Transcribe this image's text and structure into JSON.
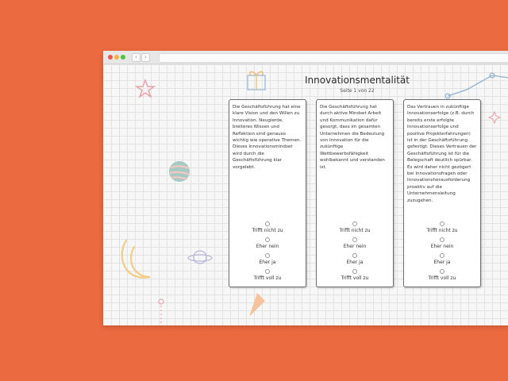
{
  "header": {
    "title": "Innovationsmentalität",
    "page_indicator": "Seite 1 von 22"
  },
  "browser": {
    "back_label": "‹",
    "forward_label": "›"
  },
  "answer_options": [
    "Trifft nicht zu",
    "Eher nein",
    "Eher ja",
    "Trifft voll zu"
  ],
  "cards": [
    {
      "statement": "Die Geschäftsführung hat eine klare Vision und den Willen zu Innovation. Neugierde, breiteres Wissen und Reflektion sind genauso wichtig wie operative Themen. Dieses Innovationsmindset wird durch die Geschäftsführung klar vorgelebt."
    },
    {
      "statement": "Die Geschäftsführung hat durch aktive Mindset Arbeit und Kommunikation dafür gesorgt, dass im gesamten Unternehmen die Bedeutung von Innovation für die zukünftige Wettbewerbsfähigkeit wohlbekannt und verstanden ist."
    },
    {
      "statement": "Das Vertrauen in zukünftige Innovationserfolge (z.B. durch bereits erste erfolgte Innovationserfolge und positive Projekterfahrungen) ist in der Geschäftsführung gefestigt. Dieses Vertrauen der Geschäftsführung ist für die Belegschaft deutlich spürbar. Es wird daher nicht gezögert bei Innovationsfragen oder Innovationsherausforderung proaktiv auf die Unternehmensleitung zuzugehen."
    }
  ],
  "colors": {
    "background": "#ec6a3f",
    "card_border": "#6f6f6f"
  }
}
